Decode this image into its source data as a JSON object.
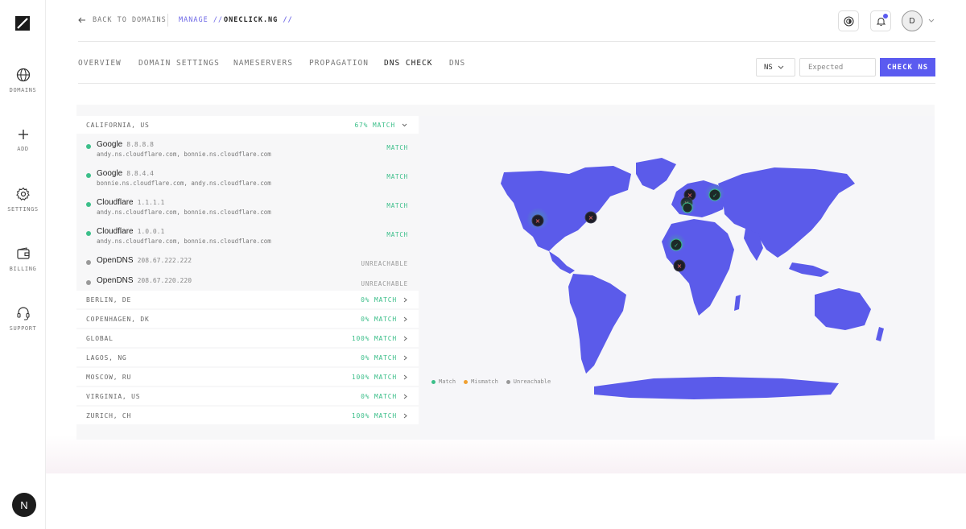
{
  "sidebar": {
    "items": [
      {
        "label": "DOMAINS",
        "icon": "globe-icon"
      },
      {
        "label": "ADD",
        "icon": "plus-icon"
      },
      {
        "label": "SETTINGS",
        "icon": "gear-icon"
      },
      {
        "label": "BILLING",
        "icon": "wallet-icon"
      },
      {
        "label": "SUPPORT",
        "icon": "headset-icon"
      }
    ],
    "footer_avatar": "N"
  },
  "header": {
    "back_label": "BACK TO DOMAINS",
    "manage_label": "MANAGE",
    "slash": "//",
    "domain": "ONECLICK.NG",
    "user_initial": "D"
  },
  "tabs": [
    {
      "label": "OVERVIEW",
      "active": false
    },
    {
      "label": "DOMAIN SETTINGS",
      "active": false
    },
    {
      "label": "NAMESERVERS",
      "active": false
    },
    {
      "label": "PROPAGATION",
      "active": false
    },
    {
      "label": "DNS CHECK",
      "active": true
    },
    {
      "label": "DNS",
      "active": false
    }
  ],
  "controls": {
    "record_type": "NS",
    "expected_placeholder": "Expected",
    "check_button": "CHECK NS"
  },
  "regions": [
    {
      "name": "CALIFORNIA, US",
      "status": "67% MATCH",
      "expanded": true,
      "resolvers": [
        {
          "provider": "Google",
          "ip": "8.8.8.8",
          "ns": "andy.ns.cloudflare.com, bonnie.ns.cloudflare.com",
          "status": "MATCH"
        },
        {
          "provider": "Google",
          "ip": "8.8.4.4",
          "ns": "bonnie.ns.cloudflare.com, andy.ns.cloudflare.com",
          "status": "MATCH"
        },
        {
          "provider": "Cloudflare",
          "ip": "1.1.1.1",
          "ns": "andy.ns.cloudflare.com, bonnie.ns.cloudflare.com",
          "status": "MATCH"
        },
        {
          "provider": "Cloudflare",
          "ip": "1.0.0.1",
          "ns": "andy.ns.cloudflare.com, bonnie.ns.cloudflare.com",
          "status": "MATCH"
        },
        {
          "provider": "OpenDNS",
          "ip": "208.67.222.222",
          "ns": "",
          "status": "UNREACHABLE"
        },
        {
          "provider": "OpenDNS",
          "ip": "208.67.220.220",
          "ns": "",
          "status": "UNREACHABLE"
        }
      ]
    },
    {
      "name": "BERLIN, DE",
      "status": "0% MATCH"
    },
    {
      "name": "COPENHAGEN, DK",
      "status": "0% MATCH"
    },
    {
      "name": "GLOBAL",
      "status": "100% MATCH"
    },
    {
      "name": "LAGOS, NG",
      "status": "0% MATCH"
    },
    {
      "name": "MOSCOW, RU",
      "status": "100% MATCH"
    },
    {
      "name": "VIRGINIA, US",
      "status": "0% MATCH"
    },
    {
      "name": "ZURICH, CH",
      "status": "100% MATCH"
    }
  ],
  "legend": [
    {
      "label": "Match",
      "color": "#3cbf8a"
    },
    {
      "label": "Mismatch",
      "color": "#f0a030"
    },
    {
      "label": "Unreachable",
      "color": "#999999"
    }
  ],
  "colors": {
    "accent": "#5b5bf0",
    "map": "#5b5bea",
    "match": "#3cbf8a",
    "unreachable": "#999999"
  }
}
